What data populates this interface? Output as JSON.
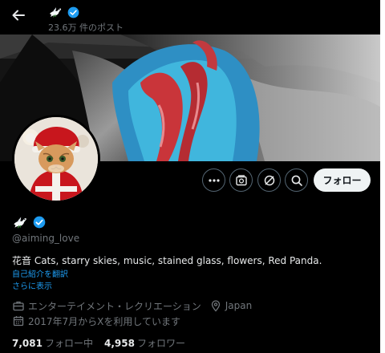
{
  "header": {
    "back_label": "戻る",
    "posts_count": "23.6万 件のポスト"
  },
  "profile": {
    "handle": "@aiming_love",
    "bio": "花音 Cats, starry skies, music, stained glass, flowers, Red Panda.",
    "translate_label": "自己紹介を翻訳",
    "show_more_label": "さらに表示",
    "category": "エンターテイメント・レクリエーション",
    "location": "Japan",
    "joined": "2017年7月からXを利用しています",
    "following_count": "7,081",
    "following_label": "フォロー中",
    "followers_count": "4,958",
    "followers_label": "フォロワー",
    "verified": true
  },
  "actions": {
    "more_icon": "more-horizontal-icon",
    "subscribe_icon": "subscription-icon",
    "grok_icon": "grok-icon",
    "search_icon": "search-icon",
    "follow_label": "フォロー"
  },
  "colors": {
    "background": "#000000",
    "text_primary": "#e7e9ea",
    "text_secondary": "#71767b",
    "accent_blue": "#1d9bf0",
    "button_border": "#536471",
    "follow_button_bg": "#eff3f4"
  }
}
